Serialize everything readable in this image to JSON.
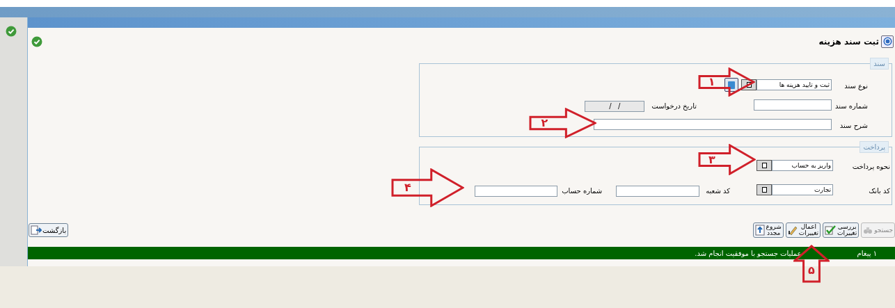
{
  "title": "ثبت سند هزینه",
  "document_section": {
    "legend": "سند",
    "doc_type": {
      "label": "نوع سند",
      "value": "ثبت و تایید هزینه ها"
    },
    "doc_number": {
      "label": "شماره سند"
    },
    "request_date": {
      "label": "تاریخ درخواست",
      "value": "/   /",
      "disabled": true
    },
    "description": {
      "label": "شرح سند"
    }
  },
  "payment_section": {
    "legend": "پرداخت",
    "method": {
      "label": "نحوه پرداخت",
      "value": "واریز به حساب"
    },
    "bank_code": {
      "label": "کد بانک",
      "value": "تجارت"
    },
    "branch_code": {
      "label": "کد شعبه"
    },
    "account_number": {
      "label": "شماره حساب"
    }
  },
  "toolbar": [
    {
      "kind": "search",
      "label": "جستجو",
      "disabled": true
    },
    {
      "kind": "check",
      "label": "بررسی\nتغییرات",
      "disabled": false
    },
    {
      "kind": "apply",
      "label": "اعمال\nتغییرات",
      "disabled": false
    },
    {
      "kind": "restart",
      "label": "شروع\nمجدد",
      "disabled": false
    }
  ],
  "back_button": "بازگشت",
  "status_bar": {
    "count": "۱ پیغام",
    "message": "عملیات جستجو با موفقیت انجام شد."
  },
  "annotations": [
    {
      "number": "۱",
      "kind": "rightward"
    },
    {
      "number": "۲",
      "kind": "rightward"
    },
    {
      "number": "۳",
      "kind": "rightward"
    },
    {
      "number": "۴",
      "kind": "rightward"
    },
    {
      "number": "۵",
      "kind": "upward"
    }
  ]
}
